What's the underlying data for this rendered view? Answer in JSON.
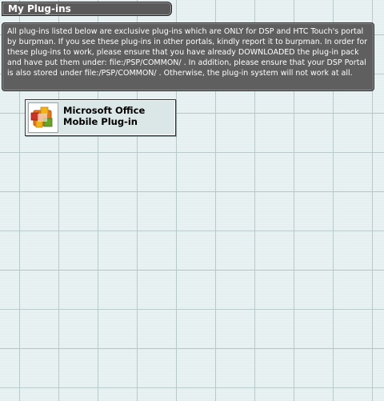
{
  "header": {
    "title": "My Plug-ins"
  },
  "notice": {
    "text": "All plug-ins listed below are exclusive plug-ins which are ONLY for DSP and HTC Touch's portal by burpman. If you see these plug-ins in other portals, kindly report it to burpman. In order for these plug-ins to work, please ensure that you have already DOWNLOADED the plug-in pack and have put them under: file:/PSP/COMMON/ . In addition, please ensure that your DSP Portal is also stored under file:/PSP/COMMON/ . Otherwise, the plug-in system will not work at all."
  },
  "plugins": [
    {
      "label": "Microsoft Office Mobile Plug-in",
      "icon": "microsoft-office-icon"
    }
  ],
  "colors": {
    "title_bar_bg": "#5a5a5a",
    "notice_bg": "#5f5f5f",
    "page_bg": "#e3eded",
    "grid_line": "#b9c8c8",
    "office_orange": "#e8741a",
    "office_red": "#c9342a",
    "office_green": "#6aa329",
    "office_yellow": "#f2b21b"
  }
}
